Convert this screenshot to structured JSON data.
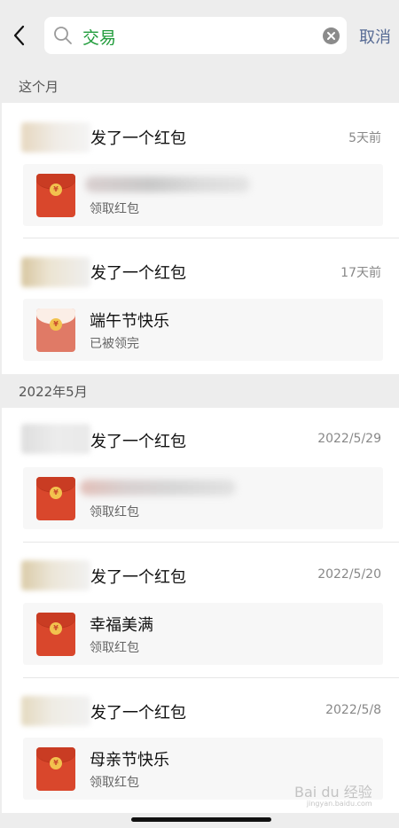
{
  "search": {
    "query": "交易",
    "cancel_label": "取消"
  },
  "sections": [
    {
      "label": "这个月"
    },
    {
      "label": "2022年5月"
    }
  ],
  "entries": [
    {
      "action": "发了一个红包",
      "time": "5天前",
      "card_title": "",
      "card_status": "领取红包",
      "envelope": "unopened"
    },
    {
      "action": "发了一个红包",
      "time": "17天前",
      "card_title": "端午节快乐",
      "card_status": "已被领完",
      "envelope": "opened"
    },
    {
      "action": "发了一个红包",
      "time": "2022/5/29",
      "card_title": "",
      "card_status": "领取红包",
      "envelope": "unopened"
    },
    {
      "action": "发了一个红包",
      "time": "2022/5/20",
      "card_title": "幸福美满",
      "card_status": "领取红包",
      "envelope": "unopened"
    },
    {
      "action": "发了一个红包",
      "time": "2022/5/8",
      "card_title": "母亲节快乐",
      "card_status": "领取红包",
      "envelope": "unopened"
    }
  ],
  "icons": {
    "coin_symbol": "¥"
  },
  "watermark": {
    "brand": "Bai du 经验",
    "url": "jingyan.baidu.com"
  },
  "colors": {
    "accent": "#576b95",
    "query": "#1f9b3a",
    "red_envelope": "#d9472c"
  }
}
